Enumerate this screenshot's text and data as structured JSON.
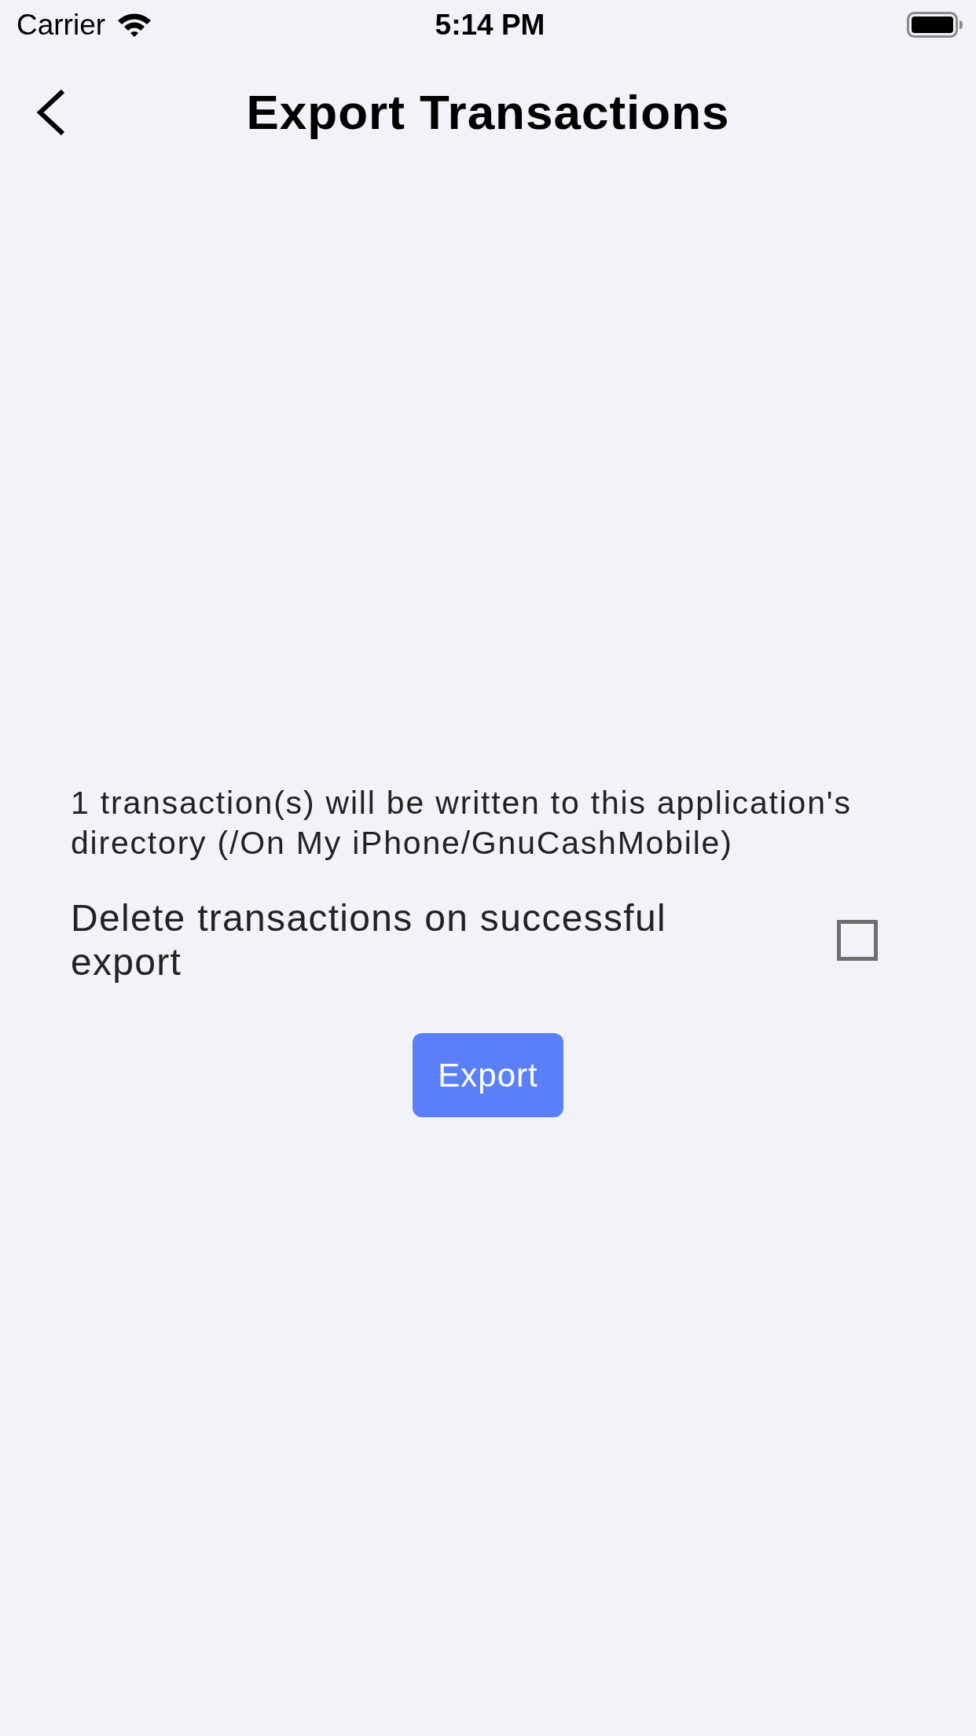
{
  "status_bar": {
    "carrier": "Carrier",
    "time": "5:14 PM"
  },
  "nav_bar": {
    "title": "Export Transactions"
  },
  "export_info": "1 transaction(s) will be written to this application's directory (/On My iPhone/GnuCashMobile)",
  "delete_option": {
    "label": "Delete transactions on successful export",
    "checked": false
  },
  "export_button": {
    "label": "Export"
  }
}
